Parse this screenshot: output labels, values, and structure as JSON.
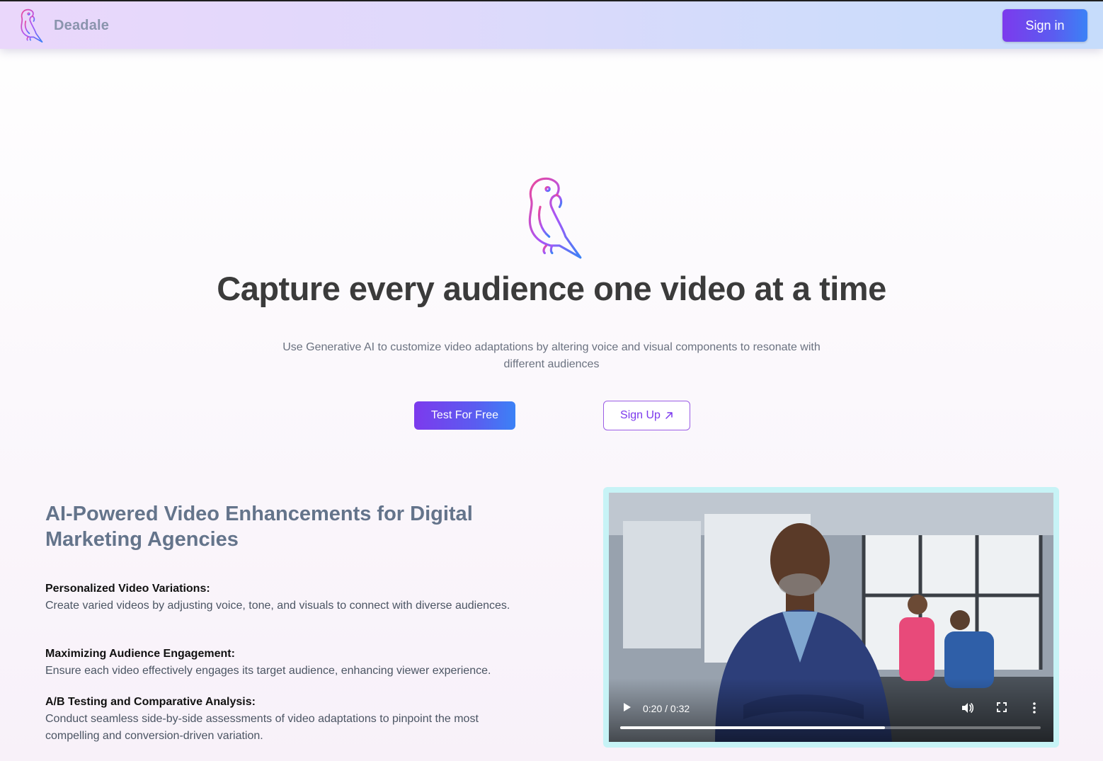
{
  "header": {
    "brand_name": "Deadale",
    "signin_label": "Sign in"
  },
  "hero": {
    "title": "Capture every audience one video at a time",
    "subtitle": "Use Generative AI to customize video adaptations by altering voice and visual components to resonate with different audiences",
    "test_button_label": "Test For Free",
    "signup_button_label": "Sign Up",
    "signup_icon": "arrow-up-right-icon"
  },
  "section": {
    "title": "AI-Powered Video Enhancements for Digital Marketing Agencies",
    "features": [
      {
        "title": "Personalized Video Variations:",
        "description": "Create varied videos by adjusting voice, tone, and visuals to connect with diverse audiences."
      },
      {
        "title": "Maximizing Audience Engagement:",
        "description": "Ensure each video effectively engages its target audience, enhancing viewer experience."
      },
      {
        "title": "A/B Testing and Comparative Analysis:",
        "description": "Conduct seamless side-by-side assessments of video adaptations to pinpoint the most compelling and conversion-driven variation."
      }
    ]
  },
  "video": {
    "time": "0:20 / 0:32",
    "progress_fraction": 0.63,
    "icons": [
      "play-icon",
      "volume-icon",
      "fullscreen-icon",
      "more-options-icon"
    ]
  },
  "colors": {
    "accent_purple": "#7c3aed",
    "accent_blue": "#3b82f6",
    "video_border": "#c7f3f6"
  }
}
